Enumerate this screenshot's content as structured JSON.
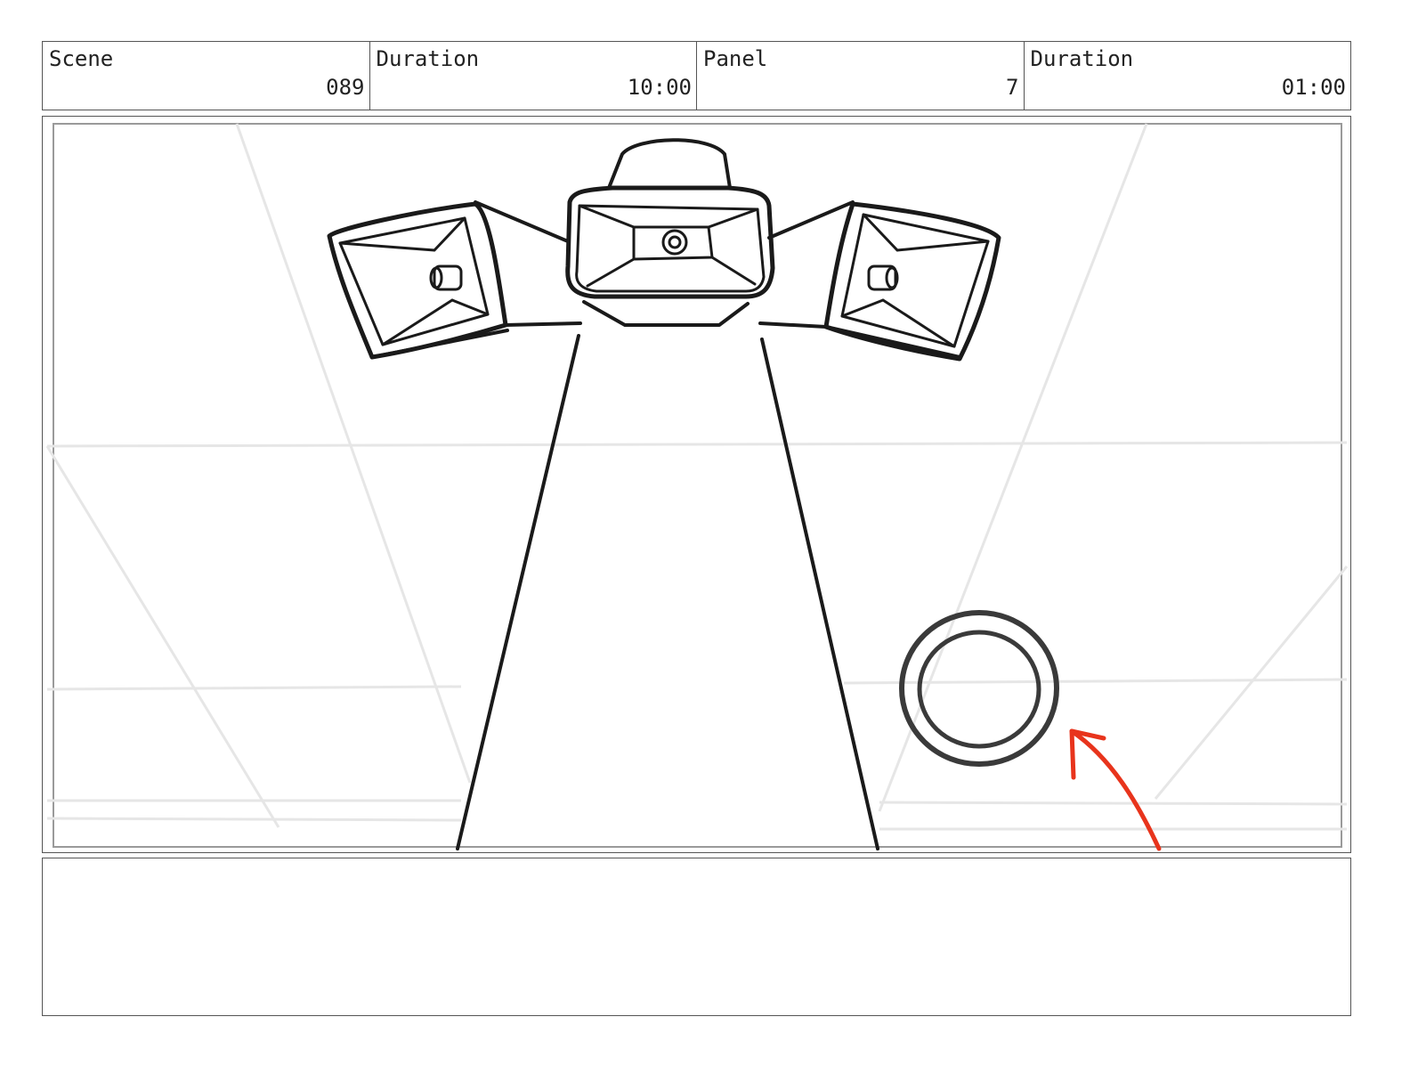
{
  "header": {
    "scene_label": "Scene",
    "scene_value": "089",
    "scene_duration_label": "Duration",
    "scene_duration_value": "10:00",
    "panel_label": "Panel",
    "panel_value": "7",
    "panel_duration_label": "Duration",
    "panel_duration_value": "01:00"
  },
  "drawing": {
    "ink_color": "#1a1a1a",
    "guide_color": "#e6e6e6",
    "arrow_color": "#e8341c",
    "ring_color": "#3a3a3a"
  },
  "notes": {
    "text": ""
  }
}
